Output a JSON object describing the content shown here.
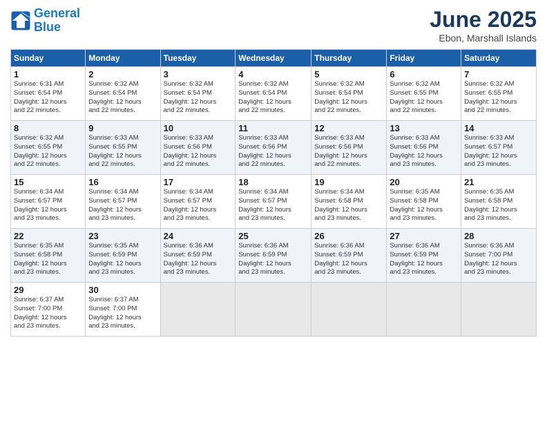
{
  "logo": {
    "line1": "General",
    "line2": "Blue"
  },
  "title": "June 2025",
  "location": "Ebon, Marshall Islands",
  "weekdays": [
    "Sunday",
    "Monday",
    "Tuesday",
    "Wednesday",
    "Thursday",
    "Friday",
    "Saturday"
  ],
  "weeks": [
    [
      {
        "day": "1",
        "info": "Sunrise: 6:31 AM\nSunset: 6:54 PM\nDaylight: 12 hours\nand 22 minutes."
      },
      {
        "day": "2",
        "info": "Sunrise: 6:32 AM\nSunset: 6:54 PM\nDaylight: 12 hours\nand 22 minutes."
      },
      {
        "day": "3",
        "info": "Sunrise: 6:32 AM\nSunset: 6:54 PM\nDaylight: 12 hours\nand 22 minutes."
      },
      {
        "day": "4",
        "info": "Sunrise: 6:32 AM\nSunset: 6:54 PM\nDaylight: 12 hours\nand 22 minutes."
      },
      {
        "day": "5",
        "info": "Sunrise: 6:32 AM\nSunset: 6:54 PM\nDaylight: 12 hours\nand 22 minutes."
      },
      {
        "day": "6",
        "info": "Sunrise: 6:32 AM\nSunset: 6:55 PM\nDaylight: 12 hours\nand 22 minutes."
      },
      {
        "day": "7",
        "info": "Sunrise: 6:32 AM\nSunset: 6:55 PM\nDaylight: 12 hours\nand 22 minutes."
      }
    ],
    [
      {
        "day": "8",
        "info": "Sunrise: 6:32 AM\nSunset: 6:55 PM\nDaylight: 12 hours\nand 22 minutes."
      },
      {
        "day": "9",
        "info": "Sunrise: 6:33 AM\nSunset: 6:55 PM\nDaylight: 12 hours\nand 22 minutes."
      },
      {
        "day": "10",
        "info": "Sunrise: 6:33 AM\nSunset: 6:56 PM\nDaylight: 12 hours\nand 22 minutes."
      },
      {
        "day": "11",
        "info": "Sunrise: 6:33 AM\nSunset: 6:56 PM\nDaylight: 12 hours\nand 22 minutes."
      },
      {
        "day": "12",
        "info": "Sunrise: 6:33 AM\nSunset: 6:56 PM\nDaylight: 12 hours\nand 22 minutes."
      },
      {
        "day": "13",
        "info": "Sunrise: 6:33 AM\nSunset: 6:56 PM\nDaylight: 12 hours\nand 23 minutes."
      },
      {
        "day": "14",
        "info": "Sunrise: 6:33 AM\nSunset: 6:57 PM\nDaylight: 12 hours\nand 23 minutes."
      }
    ],
    [
      {
        "day": "15",
        "info": "Sunrise: 6:34 AM\nSunset: 6:57 PM\nDaylight: 12 hours\nand 23 minutes."
      },
      {
        "day": "16",
        "info": "Sunrise: 6:34 AM\nSunset: 6:57 PM\nDaylight: 12 hours\nand 23 minutes."
      },
      {
        "day": "17",
        "info": "Sunrise: 6:34 AM\nSunset: 6:57 PM\nDaylight: 12 hours\nand 23 minutes."
      },
      {
        "day": "18",
        "info": "Sunrise: 6:34 AM\nSunset: 6:57 PM\nDaylight: 12 hours\nand 23 minutes."
      },
      {
        "day": "19",
        "info": "Sunrise: 6:34 AM\nSunset: 6:58 PM\nDaylight: 12 hours\nand 23 minutes."
      },
      {
        "day": "20",
        "info": "Sunrise: 6:35 AM\nSunset: 6:58 PM\nDaylight: 12 hours\nand 23 minutes."
      },
      {
        "day": "21",
        "info": "Sunrise: 6:35 AM\nSunset: 6:58 PM\nDaylight: 12 hours\nand 23 minutes."
      }
    ],
    [
      {
        "day": "22",
        "info": "Sunrise: 6:35 AM\nSunset: 6:58 PM\nDaylight: 12 hours\nand 23 minutes."
      },
      {
        "day": "23",
        "info": "Sunrise: 6:35 AM\nSunset: 6:59 PM\nDaylight: 12 hours\nand 23 minutes."
      },
      {
        "day": "24",
        "info": "Sunrise: 6:36 AM\nSunset: 6:59 PM\nDaylight: 12 hours\nand 23 minutes."
      },
      {
        "day": "25",
        "info": "Sunrise: 6:36 AM\nSunset: 6:59 PM\nDaylight: 12 hours\nand 23 minutes."
      },
      {
        "day": "26",
        "info": "Sunrise: 6:36 AM\nSunset: 6:59 PM\nDaylight: 12 hours\nand 23 minutes."
      },
      {
        "day": "27",
        "info": "Sunrise: 6:36 AM\nSunset: 6:59 PM\nDaylight: 12 hours\nand 23 minutes."
      },
      {
        "day": "28",
        "info": "Sunrise: 6:36 AM\nSunset: 7:00 PM\nDaylight: 12 hours\nand 23 minutes."
      }
    ],
    [
      {
        "day": "29",
        "info": "Sunrise: 6:37 AM\nSunset: 7:00 PM\nDaylight: 12 hours\nand 23 minutes."
      },
      {
        "day": "30",
        "info": "Sunrise: 6:37 AM\nSunset: 7:00 PM\nDaylight: 12 hours\nand 23 minutes."
      },
      {
        "day": "",
        "info": ""
      },
      {
        "day": "",
        "info": ""
      },
      {
        "day": "",
        "info": ""
      },
      {
        "day": "",
        "info": ""
      },
      {
        "day": "",
        "info": ""
      }
    ]
  ]
}
